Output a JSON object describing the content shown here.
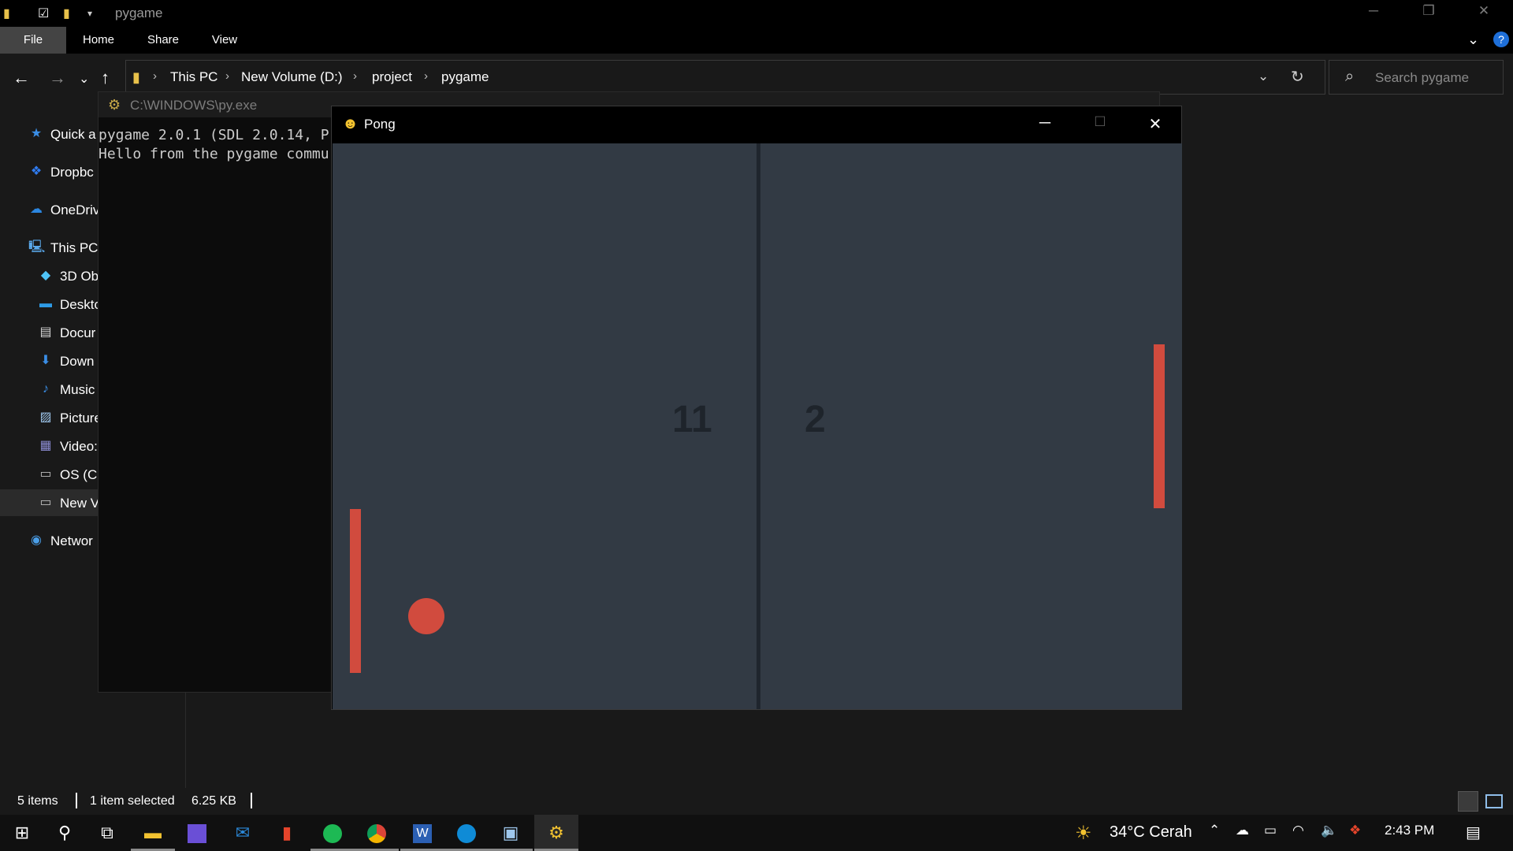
{
  "explorer": {
    "title": "pygame",
    "ribbon_tabs": [
      "File",
      "Home",
      "Share",
      "View"
    ],
    "breadcrumb": [
      "This PC",
      "New Volume (D:)",
      "project",
      "pygame"
    ],
    "search_placeholder": "Search pygame",
    "nav_items": [
      {
        "label": "Quick a",
        "icon": "star-icon"
      },
      {
        "label": "Dropbc",
        "icon": "dropbox-icon"
      },
      {
        "label": "OneDriv",
        "icon": "onedrive-icon"
      },
      {
        "label": "This PC",
        "icon": "computer-icon"
      },
      {
        "label": "3D Ob",
        "icon": "3d-objects-icon"
      },
      {
        "label": "Deskto",
        "icon": "desktop-icon"
      },
      {
        "label": "Docur",
        "icon": "documents-icon"
      },
      {
        "label": "Down",
        "icon": "downloads-icon"
      },
      {
        "label": "Music",
        "icon": "music-icon"
      },
      {
        "label": "Picture",
        "icon": "pictures-icon"
      },
      {
        "label": "Video:",
        "icon": "videos-icon"
      },
      {
        "label": "OS (C:",
        "icon": "drive-icon"
      },
      {
        "label": "New V",
        "icon": "drive-icon"
      },
      {
        "label": "Networ",
        "icon": "network-icon"
      }
    ],
    "status": {
      "items_count": "5 items",
      "selection": "1 item selected",
      "size": "6.25 KB"
    }
  },
  "console": {
    "title": "C:\\WINDOWS\\py.exe",
    "lines": [
      "pygame 2.0.1 (SDL 2.0.14, P",
      "Hello from the pygame commu"
    ]
  },
  "pong": {
    "title": "Pong",
    "score_left": "11",
    "score_right": "2"
  },
  "taskbar": {
    "apps": [
      "start-icon",
      "search-icon",
      "task-view-icon",
      "file-explorer-icon",
      "visual-studio-icon",
      "mail-icon",
      "office-icon",
      "spotify-icon",
      "chrome-icon",
      "word-icon",
      "edge-icon",
      "photos-icon",
      "python-icon"
    ],
    "weather": "34°C Cerah",
    "time": "2:43 PM"
  },
  "colors": {
    "court": "#323a44",
    "paddle": "#d14b3e",
    "score": "#1e242b"
  }
}
